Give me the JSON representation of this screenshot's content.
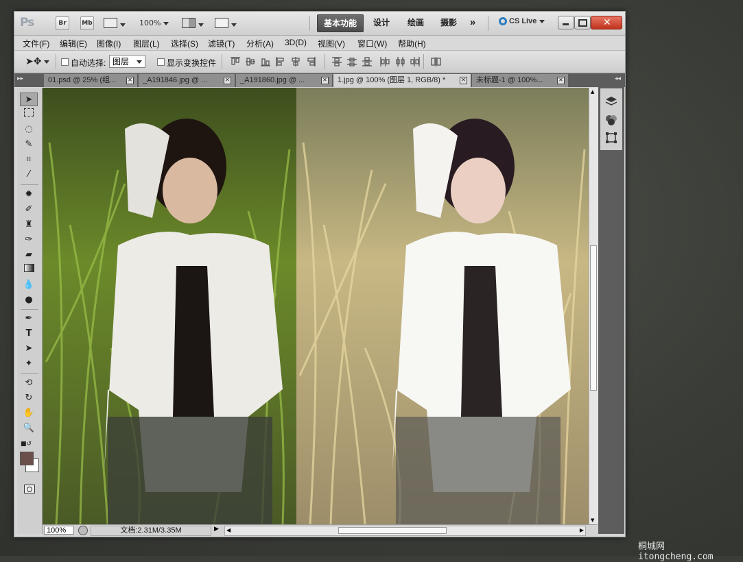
{
  "app": {
    "logo_text": "Ps"
  },
  "titlebar": {
    "bridge": "Br",
    "minibridge": "Mb",
    "zoom": "100%",
    "workspaces": [
      "基本功能",
      "设计",
      "绘画",
      "摄影"
    ],
    "more": "»",
    "cs_live": "CS Live"
  },
  "menu": [
    "文件(F)",
    "编辑(E)",
    "图像(I)",
    "图层(L)",
    "选择(S)",
    "滤镜(T)",
    "分析(A)",
    "3D(D)",
    "视图(V)",
    "窗口(W)",
    "帮助(H)"
  ],
  "options": {
    "auto_select_label": "自动选择:",
    "auto_select_value": "图层",
    "show_transform_label": "显示变换控件"
  },
  "tabs": [
    {
      "label": "01.psd @ 25% (组..."
    },
    {
      "label": "_A191846.jpg @ ..."
    },
    {
      "label": "_A191860.jpg @ ..."
    },
    {
      "label": "1.jpg @ 100% (图层 1, RGB/8) *"
    },
    {
      "label": "未标题-1 @ 100%..."
    }
  ],
  "tools": [
    "move-tool",
    "marquee-tool",
    "lasso-tool",
    "quick-select-tool",
    "crop-tool",
    "eyedropper-tool",
    "spot-heal-tool",
    "brush-tool",
    "clone-stamp-tool",
    "history-brush-tool",
    "eraser-tool",
    "gradient-tool",
    "blur-tool",
    "dodge-tool",
    "pen-tool",
    "type-tool",
    "path-select-tool",
    "shape-tool",
    "3d-rotate-tool",
    "3d-orbit-tool",
    "hand-tool",
    "zoom-tool"
  ],
  "colors": {
    "foreground": "#6b4f4a",
    "background": "#ffffff"
  },
  "status": {
    "zoom": "100%",
    "doc_info": "文档:2.31M/3.35M"
  },
  "watermark": {
    "cn": "桐城网",
    "url": "itongcheng.com"
  }
}
